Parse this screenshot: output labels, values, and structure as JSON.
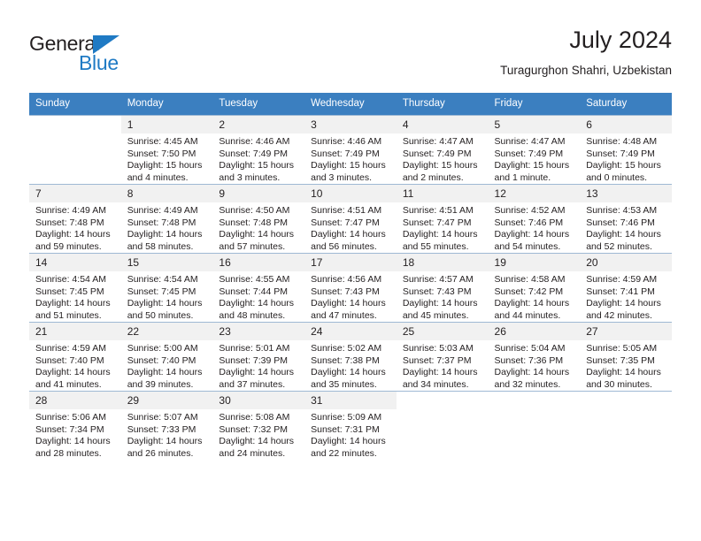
{
  "brand": {
    "name_part1": "General",
    "name_part2": "Blue",
    "triangle_color": "#1f7ac4"
  },
  "header": {
    "title": "July 2024",
    "subtitle": "Turagurghon Shahri, Uzbekistan"
  },
  "theme": {
    "header_bg": "#3b7fc0",
    "daynum_bg": "#f1f1f1",
    "grid_line": "#9fb9d4"
  },
  "weekdays": [
    "Sunday",
    "Monday",
    "Tuesday",
    "Wednesday",
    "Thursday",
    "Friday",
    "Saturday"
  ],
  "labels": {
    "sunrise_prefix": "Sunrise:",
    "sunset_prefix": "Sunset:",
    "daylight_prefix": "Daylight:"
  },
  "weeks": [
    [
      {
        "empty": true
      },
      {
        "day": "1",
        "sunrise": "Sunrise: 4:45 AM",
        "sunset": "Sunset: 7:50 PM",
        "daylight_line1": "Daylight: 15 hours",
        "daylight_line2": "and 4 minutes."
      },
      {
        "day": "2",
        "sunrise": "Sunrise: 4:46 AM",
        "sunset": "Sunset: 7:49 PM",
        "daylight_line1": "Daylight: 15 hours",
        "daylight_line2": "and 3 minutes."
      },
      {
        "day": "3",
        "sunrise": "Sunrise: 4:46 AM",
        "sunset": "Sunset: 7:49 PM",
        "daylight_line1": "Daylight: 15 hours",
        "daylight_line2": "and 3 minutes."
      },
      {
        "day": "4",
        "sunrise": "Sunrise: 4:47 AM",
        "sunset": "Sunset: 7:49 PM",
        "daylight_line1": "Daylight: 15 hours",
        "daylight_line2": "and 2 minutes."
      },
      {
        "day": "5",
        "sunrise": "Sunrise: 4:47 AM",
        "sunset": "Sunset: 7:49 PM",
        "daylight_line1": "Daylight: 15 hours",
        "daylight_line2": "and 1 minute."
      },
      {
        "day": "6",
        "sunrise": "Sunrise: 4:48 AM",
        "sunset": "Sunset: 7:49 PM",
        "daylight_line1": "Daylight: 15 hours",
        "daylight_line2": "and 0 minutes."
      }
    ],
    [
      {
        "day": "7",
        "sunrise": "Sunrise: 4:49 AM",
        "sunset": "Sunset: 7:48 PM",
        "daylight_line1": "Daylight: 14 hours",
        "daylight_line2": "and 59 minutes."
      },
      {
        "day": "8",
        "sunrise": "Sunrise: 4:49 AM",
        "sunset": "Sunset: 7:48 PM",
        "daylight_line1": "Daylight: 14 hours",
        "daylight_line2": "and 58 minutes."
      },
      {
        "day": "9",
        "sunrise": "Sunrise: 4:50 AM",
        "sunset": "Sunset: 7:48 PM",
        "daylight_line1": "Daylight: 14 hours",
        "daylight_line2": "and 57 minutes."
      },
      {
        "day": "10",
        "sunrise": "Sunrise: 4:51 AM",
        "sunset": "Sunset: 7:47 PM",
        "daylight_line1": "Daylight: 14 hours",
        "daylight_line2": "and 56 minutes."
      },
      {
        "day": "11",
        "sunrise": "Sunrise: 4:51 AM",
        "sunset": "Sunset: 7:47 PM",
        "daylight_line1": "Daylight: 14 hours",
        "daylight_line2": "and 55 minutes."
      },
      {
        "day": "12",
        "sunrise": "Sunrise: 4:52 AM",
        "sunset": "Sunset: 7:46 PM",
        "daylight_line1": "Daylight: 14 hours",
        "daylight_line2": "and 54 minutes."
      },
      {
        "day": "13",
        "sunrise": "Sunrise: 4:53 AM",
        "sunset": "Sunset: 7:46 PM",
        "daylight_line1": "Daylight: 14 hours",
        "daylight_line2": "and 52 minutes."
      }
    ],
    [
      {
        "day": "14",
        "sunrise": "Sunrise: 4:54 AM",
        "sunset": "Sunset: 7:45 PM",
        "daylight_line1": "Daylight: 14 hours",
        "daylight_line2": "and 51 minutes."
      },
      {
        "day": "15",
        "sunrise": "Sunrise: 4:54 AM",
        "sunset": "Sunset: 7:45 PM",
        "daylight_line1": "Daylight: 14 hours",
        "daylight_line2": "and 50 minutes."
      },
      {
        "day": "16",
        "sunrise": "Sunrise: 4:55 AM",
        "sunset": "Sunset: 7:44 PM",
        "daylight_line1": "Daylight: 14 hours",
        "daylight_line2": "and 48 minutes."
      },
      {
        "day": "17",
        "sunrise": "Sunrise: 4:56 AM",
        "sunset": "Sunset: 7:43 PM",
        "daylight_line1": "Daylight: 14 hours",
        "daylight_line2": "and 47 minutes."
      },
      {
        "day": "18",
        "sunrise": "Sunrise: 4:57 AM",
        "sunset": "Sunset: 7:43 PM",
        "daylight_line1": "Daylight: 14 hours",
        "daylight_line2": "and 45 minutes."
      },
      {
        "day": "19",
        "sunrise": "Sunrise: 4:58 AM",
        "sunset": "Sunset: 7:42 PM",
        "daylight_line1": "Daylight: 14 hours",
        "daylight_line2": "and 44 minutes."
      },
      {
        "day": "20",
        "sunrise": "Sunrise: 4:59 AM",
        "sunset": "Sunset: 7:41 PM",
        "daylight_line1": "Daylight: 14 hours",
        "daylight_line2": "and 42 minutes."
      }
    ],
    [
      {
        "day": "21",
        "sunrise": "Sunrise: 4:59 AM",
        "sunset": "Sunset: 7:40 PM",
        "daylight_line1": "Daylight: 14 hours",
        "daylight_line2": "and 41 minutes."
      },
      {
        "day": "22",
        "sunrise": "Sunrise: 5:00 AM",
        "sunset": "Sunset: 7:40 PM",
        "daylight_line1": "Daylight: 14 hours",
        "daylight_line2": "and 39 minutes."
      },
      {
        "day": "23",
        "sunrise": "Sunrise: 5:01 AM",
        "sunset": "Sunset: 7:39 PM",
        "daylight_line1": "Daylight: 14 hours",
        "daylight_line2": "and 37 minutes."
      },
      {
        "day": "24",
        "sunrise": "Sunrise: 5:02 AM",
        "sunset": "Sunset: 7:38 PM",
        "daylight_line1": "Daylight: 14 hours",
        "daylight_line2": "and 35 minutes."
      },
      {
        "day": "25",
        "sunrise": "Sunrise: 5:03 AM",
        "sunset": "Sunset: 7:37 PM",
        "daylight_line1": "Daylight: 14 hours",
        "daylight_line2": "and 34 minutes."
      },
      {
        "day": "26",
        "sunrise": "Sunrise: 5:04 AM",
        "sunset": "Sunset: 7:36 PM",
        "daylight_line1": "Daylight: 14 hours",
        "daylight_line2": "and 32 minutes."
      },
      {
        "day": "27",
        "sunrise": "Sunrise: 5:05 AM",
        "sunset": "Sunset: 7:35 PM",
        "daylight_line1": "Daylight: 14 hours",
        "daylight_line2": "and 30 minutes."
      }
    ],
    [
      {
        "day": "28",
        "sunrise": "Sunrise: 5:06 AM",
        "sunset": "Sunset: 7:34 PM",
        "daylight_line1": "Daylight: 14 hours",
        "daylight_line2": "and 28 minutes."
      },
      {
        "day": "29",
        "sunrise": "Sunrise: 5:07 AM",
        "sunset": "Sunset: 7:33 PM",
        "daylight_line1": "Daylight: 14 hours",
        "daylight_line2": "and 26 minutes."
      },
      {
        "day": "30",
        "sunrise": "Sunrise: 5:08 AM",
        "sunset": "Sunset: 7:32 PM",
        "daylight_line1": "Daylight: 14 hours",
        "daylight_line2": "and 24 minutes."
      },
      {
        "day": "31",
        "sunrise": "Sunrise: 5:09 AM",
        "sunset": "Sunset: 7:31 PM",
        "daylight_line1": "Daylight: 14 hours",
        "daylight_line2": "and 22 minutes."
      },
      {
        "empty": true
      },
      {
        "empty": true
      },
      {
        "empty": true
      }
    ]
  ]
}
